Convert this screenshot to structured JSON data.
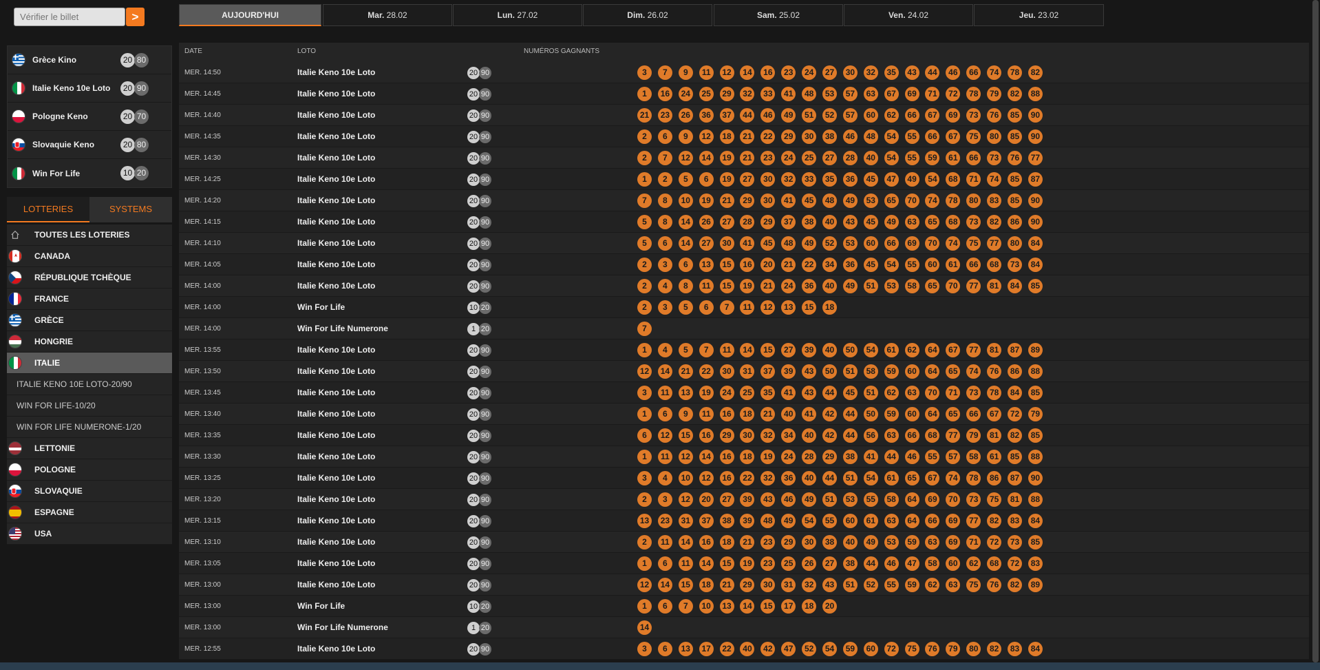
{
  "search": {
    "placeholder": "Vérifier le billet",
    "button": ">"
  },
  "featured": [
    {
      "name": "Grèce Kino",
      "a": "20",
      "b": "80",
      "flag": "gr"
    },
    {
      "name": "Italie Keno 10e Loto",
      "a": "20",
      "b": "90",
      "flag": "it"
    },
    {
      "name": "Pologne Keno",
      "a": "20",
      "b": "70",
      "flag": "pl"
    },
    {
      "name": "Slovaquie Keno",
      "a": "20",
      "b": "80",
      "flag": "sk"
    },
    {
      "name": "Win For Life",
      "a": "10",
      "b": "20",
      "flag": "it"
    }
  ],
  "tabs": {
    "lotteries": "LOTTERIES",
    "systems": "SYSTEMS"
  },
  "countries": [
    {
      "name": "TOUTES LES LOTERIES",
      "flag": "home"
    },
    {
      "name": "CANADA",
      "flag": "ca"
    },
    {
      "name": "RÉPUBLIQUE TCHÈQUE",
      "flag": "cz"
    },
    {
      "name": "FRANCE",
      "flag": "fr"
    },
    {
      "name": "GRÈCE",
      "flag": "gr"
    },
    {
      "name": "HONGRIE",
      "flag": "hu"
    },
    {
      "name": "ITALIE",
      "flag": "it"
    }
  ],
  "italy_sub": [
    "ITALIE KENO 10E LOTO-20/90",
    "WIN FOR LIFE-10/20",
    "WIN FOR LIFE NUMERONE-1/20"
  ],
  "countries2": [
    {
      "name": "LETTONIE",
      "flag": "lv"
    },
    {
      "name": "POLOGNE",
      "flag": "pl"
    },
    {
      "name": "SLOVAQUIE",
      "flag": "sk"
    },
    {
      "name": "ESPAGNE",
      "flag": "es"
    },
    {
      "name": "USA",
      "flag": "us"
    }
  ],
  "dates": [
    {
      "day": "AUJOURD'HUI",
      "date": ""
    },
    {
      "day": "Mar.",
      "date": "28.02"
    },
    {
      "day": "Lun.",
      "date": "27.02"
    },
    {
      "day": "Dim.",
      "date": "26.02"
    },
    {
      "day": "Sam.",
      "date": "25.02"
    },
    {
      "day": "Ven.",
      "date": "24.02"
    },
    {
      "day": "Jeu.",
      "date": "23.02"
    }
  ],
  "table_headers": {
    "date": "DATE",
    "loto": "LOTO",
    "numbers": "NUMÉROS GAGNANTS"
  },
  "results": [
    {
      "time": "MER. 14:50",
      "lotto": "Italie Keno 10e Loto",
      "a": "20",
      "b": "90",
      "nums": [
        3,
        7,
        9,
        11,
        12,
        14,
        16,
        23,
        24,
        27,
        30,
        32,
        35,
        43,
        44,
        46,
        66,
        74,
        78,
        82
      ]
    },
    {
      "time": "MER. 14:45",
      "lotto": "Italie Keno 10e Loto",
      "a": "20",
      "b": "90",
      "nums": [
        1,
        16,
        24,
        25,
        29,
        32,
        33,
        41,
        48,
        53,
        57,
        63,
        67,
        69,
        71,
        72,
        78,
        79,
        82,
        88
      ]
    },
    {
      "time": "MER. 14:40",
      "lotto": "Italie Keno 10e Loto",
      "a": "20",
      "b": "90",
      "nums": [
        21,
        23,
        26,
        36,
        37,
        44,
        46,
        49,
        51,
        52,
        57,
        60,
        62,
        66,
        67,
        69,
        73,
        76,
        85,
        90
      ]
    },
    {
      "time": "MER. 14:35",
      "lotto": "Italie Keno 10e Loto",
      "a": "20",
      "b": "90",
      "nums": [
        2,
        6,
        9,
        12,
        18,
        21,
        22,
        29,
        30,
        38,
        46,
        48,
        54,
        55,
        66,
        67,
        75,
        80,
        85,
        90
      ]
    },
    {
      "time": "MER. 14:30",
      "lotto": "Italie Keno 10e Loto",
      "a": "20",
      "b": "90",
      "nums": [
        2,
        7,
        12,
        14,
        19,
        21,
        23,
        24,
        25,
        27,
        28,
        40,
        54,
        55,
        59,
        61,
        66,
        73,
        76,
        77
      ]
    },
    {
      "time": "MER. 14:25",
      "lotto": "Italie Keno 10e Loto",
      "a": "20",
      "b": "90",
      "nums": [
        1,
        2,
        5,
        6,
        19,
        27,
        30,
        32,
        33,
        35,
        36,
        45,
        47,
        49,
        54,
        68,
        71,
        74,
        85,
        87
      ]
    },
    {
      "time": "MER. 14:20",
      "lotto": "Italie Keno 10e Loto",
      "a": "20",
      "b": "90",
      "nums": [
        7,
        8,
        10,
        19,
        21,
        29,
        30,
        41,
        45,
        48,
        49,
        53,
        65,
        70,
        74,
        78,
        80,
        83,
        85,
        90
      ]
    },
    {
      "time": "MER. 14:15",
      "lotto": "Italie Keno 10e Loto",
      "a": "20",
      "b": "90",
      "nums": [
        5,
        8,
        14,
        26,
        27,
        28,
        29,
        37,
        38,
        40,
        43,
        45,
        49,
        63,
        65,
        68,
        73,
        82,
        86,
        90
      ]
    },
    {
      "time": "MER. 14:10",
      "lotto": "Italie Keno 10e Loto",
      "a": "20",
      "b": "90",
      "nums": [
        5,
        6,
        14,
        27,
        30,
        41,
        45,
        48,
        49,
        52,
        53,
        60,
        66,
        69,
        70,
        74,
        75,
        77,
        80,
        84
      ]
    },
    {
      "time": "MER. 14:05",
      "lotto": "Italie Keno 10e Loto",
      "a": "20",
      "b": "90",
      "nums": [
        2,
        3,
        6,
        13,
        15,
        16,
        20,
        21,
        22,
        34,
        36,
        45,
        54,
        55,
        60,
        61,
        66,
        68,
        73,
        84
      ]
    },
    {
      "time": "MER. 14:00",
      "lotto": "Italie Keno 10e Loto",
      "a": "20",
      "b": "90",
      "nums": [
        2,
        4,
        8,
        11,
        15,
        19,
        21,
        24,
        36,
        40,
        49,
        51,
        53,
        58,
        65,
        70,
        77,
        81,
        84,
        85
      ]
    },
    {
      "time": "MER. 14:00",
      "lotto": "Win For Life",
      "a": "10",
      "b": "20",
      "nums": [
        2,
        3,
        5,
        6,
        7,
        11,
        12,
        13,
        15,
        18
      ]
    },
    {
      "time": "MER. 14:00",
      "lotto": "Win For Life Numerone",
      "a": "1",
      "b": "20",
      "nums": [
        7
      ]
    },
    {
      "time": "MER. 13:55",
      "lotto": "Italie Keno 10e Loto",
      "a": "20",
      "b": "90",
      "nums": [
        1,
        4,
        5,
        7,
        11,
        14,
        15,
        27,
        39,
        40,
        50,
        54,
        61,
        62,
        64,
        67,
        77,
        81,
        87,
        89
      ]
    },
    {
      "time": "MER. 13:50",
      "lotto": "Italie Keno 10e Loto",
      "a": "20",
      "b": "90",
      "nums": [
        12,
        14,
        21,
        22,
        30,
        31,
        37,
        39,
        43,
        50,
        51,
        58,
        59,
        60,
        64,
        65,
        74,
        76,
        86,
        88
      ]
    },
    {
      "time": "MER. 13:45",
      "lotto": "Italie Keno 10e Loto",
      "a": "20",
      "b": "90",
      "nums": [
        3,
        11,
        13,
        19,
        24,
        25,
        35,
        41,
        43,
        44,
        45,
        51,
        62,
        63,
        70,
        71,
        73,
        78,
        84,
        85
      ]
    },
    {
      "time": "MER. 13:40",
      "lotto": "Italie Keno 10e Loto",
      "a": "20",
      "b": "90",
      "nums": [
        1,
        6,
        9,
        11,
        16,
        18,
        21,
        40,
        41,
        42,
        44,
        50,
        59,
        60,
        64,
        65,
        66,
        67,
        72,
        79
      ]
    },
    {
      "time": "MER. 13:35",
      "lotto": "Italie Keno 10e Loto",
      "a": "20",
      "b": "90",
      "nums": [
        6,
        12,
        15,
        16,
        29,
        30,
        32,
        34,
        40,
        42,
        44,
        56,
        63,
        66,
        68,
        77,
        79,
        81,
        82,
        85
      ]
    },
    {
      "time": "MER. 13:30",
      "lotto": "Italie Keno 10e Loto",
      "a": "20",
      "b": "90",
      "nums": [
        1,
        11,
        12,
        14,
        16,
        18,
        19,
        24,
        28,
        29,
        38,
        41,
        44,
        46,
        55,
        57,
        58,
        61,
        85,
        88
      ]
    },
    {
      "time": "MER. 13:25",
      "lotto": "Italie Keno 10e Loto",
      "a": "20",
      "b": "90",
      "nums": [
        3,
        4,
        10,
        12,
        16,
        22,
        32,
        36,
        40,
        44,
        51,
        54,
        61,
        65,
        67,
        74,
        78,
        86,
        87,
        90
      ]
    },
    {
      "time": "MER. 13:20",
      "lotto": "Italie Keno 10e Loto",
      "a": "20",
      "b": "90",
      "nums": [
        2,
        3,
        12,
        20,
        27,
        39,
        43,
        46,
        49,
        51,
        53,
        55,
        58,
        64,
        69,
        70,
        73,
        75,
        81,
        88
      ]
    },
    {
      "time": "MER. 13:15",
      "lotto": "Italie Keno 10e Loto",
      "a": "20",
      "b": "90",
      "nums": [
        13,
        23,
        31,
        37,
        38,
        39,
        48,
        49,
        54,
        55,
        60,
        61,
        63,
        64,
        66,
        69,
        77,
        82,
        83,
        84
      ]
    },
    {
      "time": "MER. 13:10",
      "lotto": "Italie Keno 10e Loto",
      "a": "20",
      "b": "90",
      "nums": [
        2,
        11,
        14,
        16,
        18,
        21,
        23,
        29,
        30,
        38,
        40,
        49,
        53,
        59,
        63,
        69,
        71,
        72,
        73,
        85
      ]
    },
    {
      "time": "MER. 13:05",
      "lotto": "Italie Keno 10e Loto",
      "a": "20",
      "b": "90",
      "nums": [
        1,
        6,
        11,
        14,
        15,
        19,
        23,
        25,
        26,
        27,
        38,
        44,
        46,
        47,
        58,
        60,
        62,
        68,
        72,
        83
      ]
    },
    {
      "time": "MER. 13:00",
      "lotto": "Italie Keno 10e Loto",
      "a": "20",
      "b": "90",
      "nums": [
        12,
        14,
        15,
        18,
        21,
        29,
        30,
        31,
        32,
        43,
        51,
        52,
        55,
        59,
        62,
        63,
        75,
        76,
        82,
        89
      ]
    },
    {
      "time": "MER. 13:00",
      "lotto": "Win For Life",
      "a": "10",
      "b": "20",
      "nums": [
        1,
        6,
        7,
        10,
        13,
        14,
        15,
        17,
        18,
        20
      ]
    },
    {
      "time": "MER. 13:00",
      "lotto": "Win For Life Numerone",
      "a": "1",
      "b": "20",
      "nums": [
        14
      ]
    },
    {
      "time": "MER. 12:55",
      "lotto": "Italie Keno 10e Loto",
      "a": "20",
      "b": "90",
      "nums": [
        3,
        6,
        13,
        17,
        22,
        40,
        42,
        47,
        52,
        54,
        59,
        60,
        72,
        75,
        76,
        79,
        80,
        82,
        83,
        84
      ]
    }
  ],
  "colors": {
    "accent": "#f47a20",
    "ball": "#e07b29",
    "panel": "#252525",
    "bg": "#171717"
  }
}
